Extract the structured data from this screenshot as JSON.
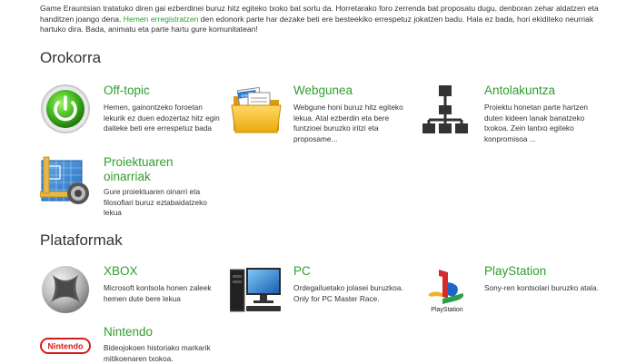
{
  "intro": {
    "text_before": "Game Erauntsian tratatuko diren gai ezberdinei buruz hitz egiteko txoko bat sortu da. Horretarako foro zerrenda bat proposatu dugu, denboran zehar aldatzen eta handitzen joango dena. ",
    "link": "Hemen erregistratzen",
    "text_after": " den edonork parte har dezake beti ere besteekiko errespetuz jokatzen badu. Hala ez bada, hori ekiditeko neurriak hartuko dira. Bada, animatu eta parte hartu gure komunitatean!"
  },
  "sections": [
    {
      "title": "Orokorra",
      "forums": [
        {
          "title": "Off-topic",
          "icon": "power-icon",
          "desc": "Hemen, gainontzeko foroetan lekurik ez duen edozertaz hitz egin daiteke beti ere errespetuz bada"
        },
        {
          "title": "Webgunea",
          "icon": "folder-web-icon",
          "desc": "Webgune honi buruz hitz egiteko lekua. Atal ezberdin eta bere funtzioei buruzko iritzi eta proposame..."
        },
        {
          "title": "Antolakuntza",
          "icon": "org-chart-icon",
          "desc": "Proiektu honetan parte hartzen duten kideen lanak banatzeko txokoa. Zein lantxo egiteko konpromisoa ..."
        },
        {
          "title": "Proiektuaren oinarriak",
          "icon": "blueprint-icon",
          "desc": "Gure proiektuaren oinarri eta filosofiari buruz eztabaidatzeko lekua"
        }
      ]
    },
    {
      "title": "Plataformak",
      "forums": [
        {
          "title": "XBOX",
          "icon": "xbox-icon",
          "desc": "Microsoft kontsola honen zaleek hemen dute bere lekua"
        },
        {
          "title": "PC",
          "icon": "pc-icon",
          "desc": "Ordegailuetako jolasei buruzkoa. Only for PC Master Race."
        },
        {
          "title": "PlayStation",
          "icon": "playstation-icon",
          "desc": "Sony-ren kontsolari buruzko atala.",
          "logo_text": "PlayStation"
        },
        {
          "title": "Nintendo",
          "icon": "nintendo-icon",
          "desc": "Bideojokoen historiako markarik mitikoenaren txokoa.",
          "logo_text": "Nintendo"
        }
      ]
    }
  ]
}
